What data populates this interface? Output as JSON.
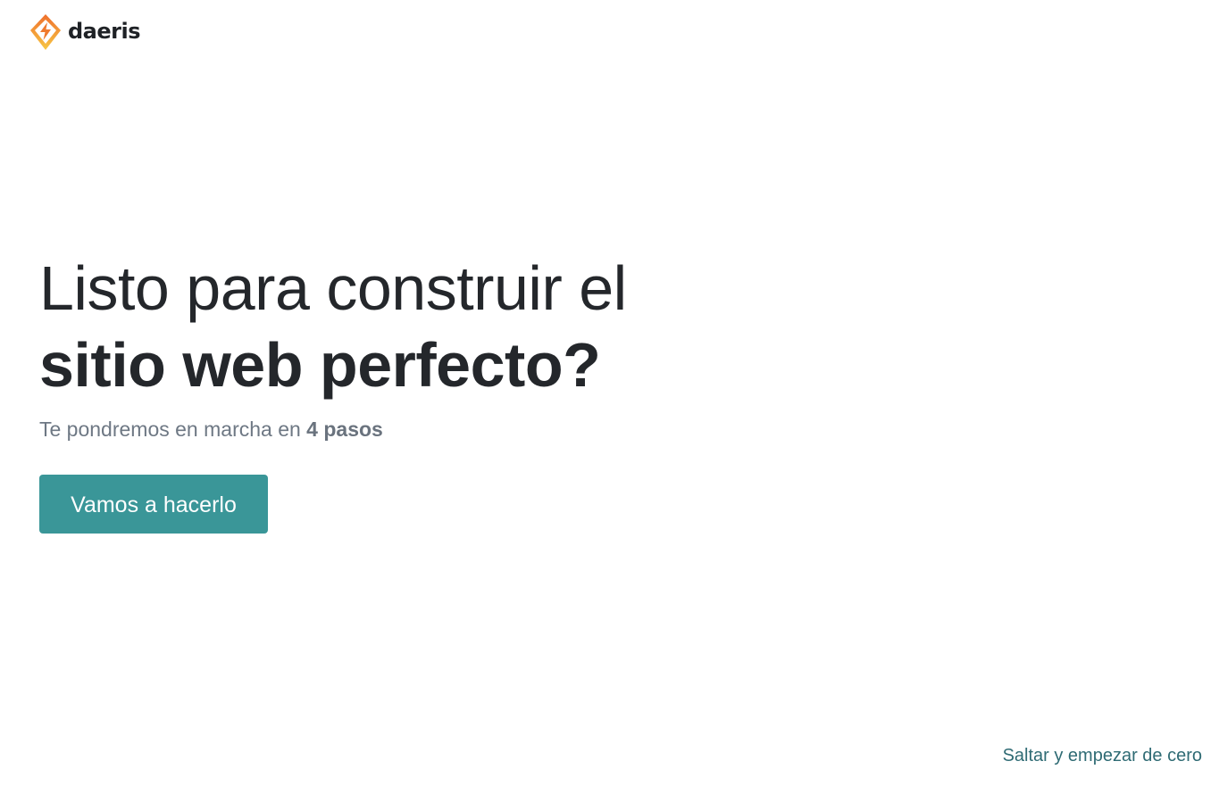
{
  "brand": {
    "name": "daeris",
    "logo_icon": "lightning-diamond-icon",
    "colors": {
      "logo_orange": "#f07f2e",
      "logo_yellow": "#f6c443"
    }
  },
  "hero": {
    "headline_line1": "Listo para construir el",
    "headline_line2": "sitio web perfecto?",
    "subtitle_prefix": "Te pondremos en marcha en ",
    "subtitle_emphasis": "4 pasos"
  },
  "actions": {
    "start_label": "Vamos a hacerlo",
    "skip_label": "Saltar y empezar de cero"
  },
  "theme": {
    "accent": "#3a9698",
    "text_dark": "#24272b",
    "text_muted": "#6e7884",
    "link": "#2f6b74"
  }
}
